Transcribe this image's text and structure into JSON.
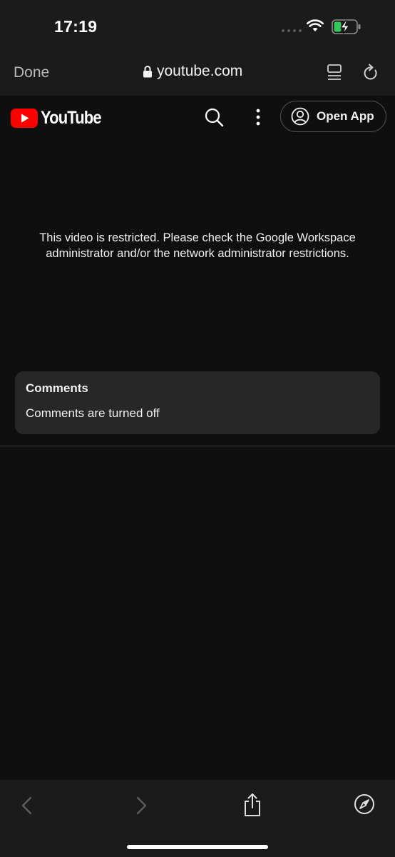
{
  "status_bar": {
    "time": "17:19",
    "icons": [
      "cellular-dots-icon",
      "wifi-icon",
      "battery-charging-icon"
    ],
    "battery_color": "#34c759"
  },
  "browser": {
    "done_label": "Done",
    "url": "youtube.com",
    "icons": [
      "lock-icon",
      "reader-icon",
      "reload-icon"
    ]
  },
  "youtube": {
    "logo_text": "YouTube",
    "brand_color": "#ff0000",
    "open_app_label": "Open App",
    "icons": [
      "search-icon",
      "more-vert-icon",
      "account-icon"
    ]
  },
  "player": {
    "message": "This video is restricted. Please check the Google Workspace administrator and/or the network administrator restrictions."
  },
  "comments": {
    "title": "Comments",
    "status": "Comments are turned off"
  },
  "toolbar": {
    "icons": [
      "back-icon",
      "forward-icon",
      "share-icon",
      "compass-icon"
    ]
  }
}
